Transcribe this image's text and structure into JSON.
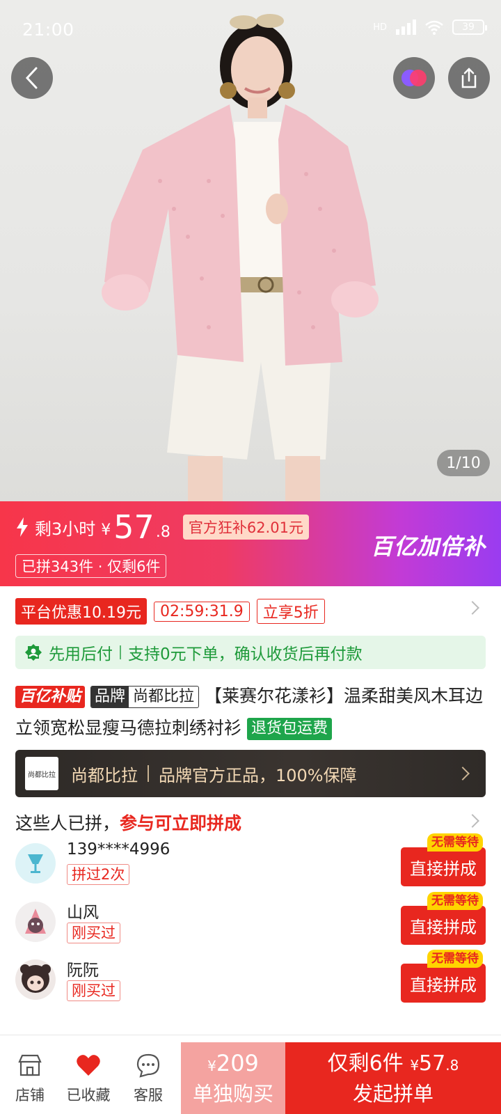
{
  "status_bar": {
    "time": "21:00",
    "network": "HD",
    "battery": "39"
  },
  "gallery": {
    "page_indicator": "1/10"
  },
  "promo": {
    "remaining": "剩3小时",
    "currency": "¥",
    "price_int": "57",
    "price_dec": ".8",
    "subsidy": "官方狂补62.01元",
    "sold": "已拼343件 · 仅剩6件",
    "brand_campaign": "百亿加倍补"
  },
  "coupon": {
    "platform_discount": "平台优惠10.19元",
    "countdown": "02:59:31.9",
    "offer": "立享5折"
  },
  "paylater": {
    "title": "先用后付",
    "desc": "支持0元下单，确认收货后再付款"
  },
  "product": {
    "tag_campaign": "百亿补贴",
    "brand_key": "品牌",
    "brand_value": "尚都比拉",
    "title": "【莱赛尔花漾衫】温柔甜美风木耳边立领宽松显瘦马德拉刺绣衬衫",
    "return_tag": "退货包运费"
  },
  "brand_bar": {
    "logo_text": "尚都比拉",
    "name": "尚都比拉",
    "slogan": "品牌官方正品，100%保障"
  },
  "group_buy": {
    "head": "这些人已拼，",
    "head_highlight": "参与可立即拼成",
    "members": [
      {
        "name": "139****4996",
        "tag": "拼过2次",
        "badge": "无需等待",
        "button": "直接拼成"
      },
      {
        "name": "山风",
        "tag": "刚买过",
        "badge": "无需等待",
        "button": "直接拼成"
      },
      {
        "name": "阮阮",
        "tag": "刚买过",
        "badge": "无需等待",
        "button": "直接拼成"
      }
    ]
  },
  "bottom_bar": {
    "store": "店铺",
    "favorite": "已收藏",
    "service": "客服",
    "alone_price_symbol": "¥",
    "alone_price": "209",
    "alone_label": "单独购买",
    "group_prefix": "仅剩6件",
    "group_price_symbol": "¥",
    "group_price_int": "57",
    "group_price_dec": ".8",
    "group_label": "发起拼单"
  },
  "colors": {
    "accent_red": "#e8271f",
    "promo_purple": "#9a3cf0",
    "paylater_green": "#1e9a3a",
    "brand_gold": "#f3d9b5"
  }
}
